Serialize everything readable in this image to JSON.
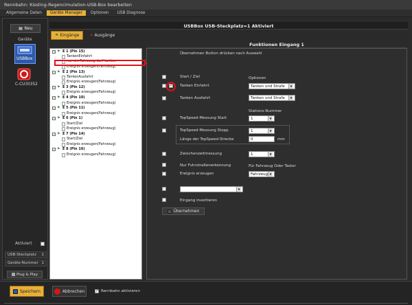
{
  "window_title": "Rennbahn: Kissling-Regencimulation-USB-Box bearbeiten",
  "menu": [
    "Allgemeine Daten",
    "Geräte Manager",
    "Optionen",
    "USB Diagnose"
  ],
  "left": {
    "new_label": "Neu",
    "devices_label": "Geräte",
    "devices": [
      "USBBox",
      "C-CU30352"
    ],
    "aktiviert_label": "Aktiviert",
    "rows": [
      {
        "label": "USB-Steckplatz",
        "value": "1"
      },
      {
        "label": "Geräte-Nummer",
        "value": "1"
      }
    ],
    "plug_label": "Plug & Play"
  },
  "header": {
    "title": "USBBox  USB-Steckplatz=1  Aktiviert"
  },
  "tabs": [
    "Eingänge",
    "Ausgänge"
  ],
  "tree": [
    {
      "label": "E 1 (Pin 15)",
      "kind": "group"
    },
    {
      "label": "TankenEinfahrt",
      "kind": "item"
    },
    {
      "label": "nur ein Fahrzeug darf tanken",
      "kind": "item"
    },
    {
      "label": "Ereignis erzeugen(Fahrzeug)",
      "kind": "item"
    },
    {
      "label": "E 2 (Pin 13)",
      "kind": "group"
    },
    {
      "label": "TankenAusfahrt",
      "kind": "item"
    },
    {
      "label": "Ereignis erzeugen(Fahrzeug)",
      "kind": "item"
    },
    {
      "label": "E 3 (Pin 12)",
      "kind": "group"
    },
    {
      "label": "Ereignis erzeugen(Fahrzeug)",
      "kind": "item"
    },
    {
      "label": "E 4 (Pin 10)",
      "kind": "group"
    },
    {
      "label": "Ereignis erzeugen(Fahrzeug)",
      "kind": "item"
    },
    {
      "label": "E 5 (Pin 11)",
      "kind": "group"
    },
    {
      "label": "Ereignis erzeugen(Fahrzeug)",
      "kind": "item"
    },
    {
      "label": "E 6 (Pin 1)",
      "kind": "group"
    },
    {
      "label": "Start/Ziel",
      "kind": "item"
    },
    {
      "label": "Ereignis erzeugen(Fahrzeug)",
      "kind": "item"
    },
    {
      "label": "E 7 (Pin 14)",
      "kind": "group"
    },
    {
      "label": "Start/Ziel",
      "kind": "item"
    },
    {
      "label": "Ereignis erzeugen(Fahrzeug)",
      "kind": "item"
    },
    {
      "label": "E 8 (Pin 16)",
      "kind": "group"
    },
    {
      "label": "Ereignis erzeugen(Fahrzeug)",
      "kind": "item"
    }
  ],
  "functions": {
    "title": "Funktionen Eingang 1",
    "hint": "Übernehmen Button drücken nach Auswahl",
    "start_ziel": "Start / Ziel",
    "tanken_einfahrt": "Tanken Einfahrt",
    "tanken_ausfahrt": "Tanken Ausfahrt",
    "optionen_label": "Optionen",
    "optionen_value_1": "Tanken und Strafe",
    "optionen_value_2": "Tanken und Strafe",
    "stations_label": "Stations-Nummer",
    "ts_start": "TopSpeed-Messung Start",
    "ts_start_value": "1",
    "ts_stopp": "TopSpeed-Messung Stopp",
    "ts_stopp_value": "1",
    "laenge_label": "Länge der TopSpeed-Strecke",
    "laenge_value": "0",
    "laenge_unit": "mm",
    "zwischen": "Zwischenzeitmessung",
    "zwischen_value": "1",
    "nur_fuhrstrasse": "Nur Fuhrstraßenerkennung",
    "ereignis": "Ereignis erzeugen",
    "fuer_label": "Für Fahrzeug Oder Taster",
    "fuer_value": "Fahrzeug",
    "empty_select": "",
    "eingang_inv": "Eingang invertieren",
    "uebernehmen": "Übernehmen"
  },
  "bottom": {
    "save": "Speichern",
    "cancel": "Abbrechen",
    "rennbahn": "Rennbahn aktivieren"
  }
}
